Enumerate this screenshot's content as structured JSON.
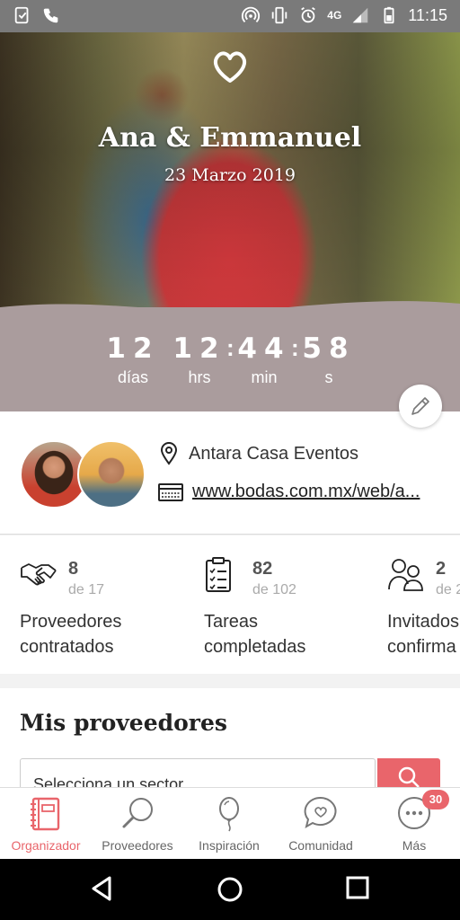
{
  "statusbar": {
    "network": "4G",
    "time": "11:15"
  },
  "hero": {
    "couple": "Ana & Emmanuel",
    "date": "23 Marzo 2019"
  },
  "countdown": {
    "days": "12",
    "days_label": "días",
    "hours": "12",
    "hours_label": "hrs",
    "minutes": "44",
    "minutes_label": "min",
    "seconds": "58",
    "seconds_label": "s",
    "separator": ":"
  },
  "venue": {
    "name": "Antara Casa Eventos",
    "website": "www.bodas.com.mx/web/a..."
  },
  "stats": [
    {
      "value": "8",
      "of": "de 17",
      "line1": "Proveedores",
      "line2": "contratados"
    },
    {
      "value": "82",
      "of": "de 102",
      "line1": "Tareas",
      "line2": "completadas"
    },
    {
      "value": "2",
      "of": "de 2",
      "line1": "Invitados",
      "line2": "confirma"
    }
  ],
  "vendors": {
    "title": "Mis proveedores",
    "sector_placeholder": "Selecciona un sector"
  },
  "bottomnav": {
    "items": [
      {
        "label": "Organizador",
        "icon": "planner-icon",
        "active": true
      },
      {
        "label": "Proveedores",
        "icon": "search-icon"
      },
      {
        "label": "Inspiración",
        "icon": "balloon-icon"
      },
      {
        "label": "Comunidad",
        "icon": "chat-heart-icon"
      },
      {
        "label": "Más",
        "icon": "more-icon",
        "badge": "30"
      }
    ]
  },
  "colors": {
    "accent": "#e9656b",
    "countdown_band": "#aa9c9d",
    "status_bar": "#7a7a7a"
  }
}
